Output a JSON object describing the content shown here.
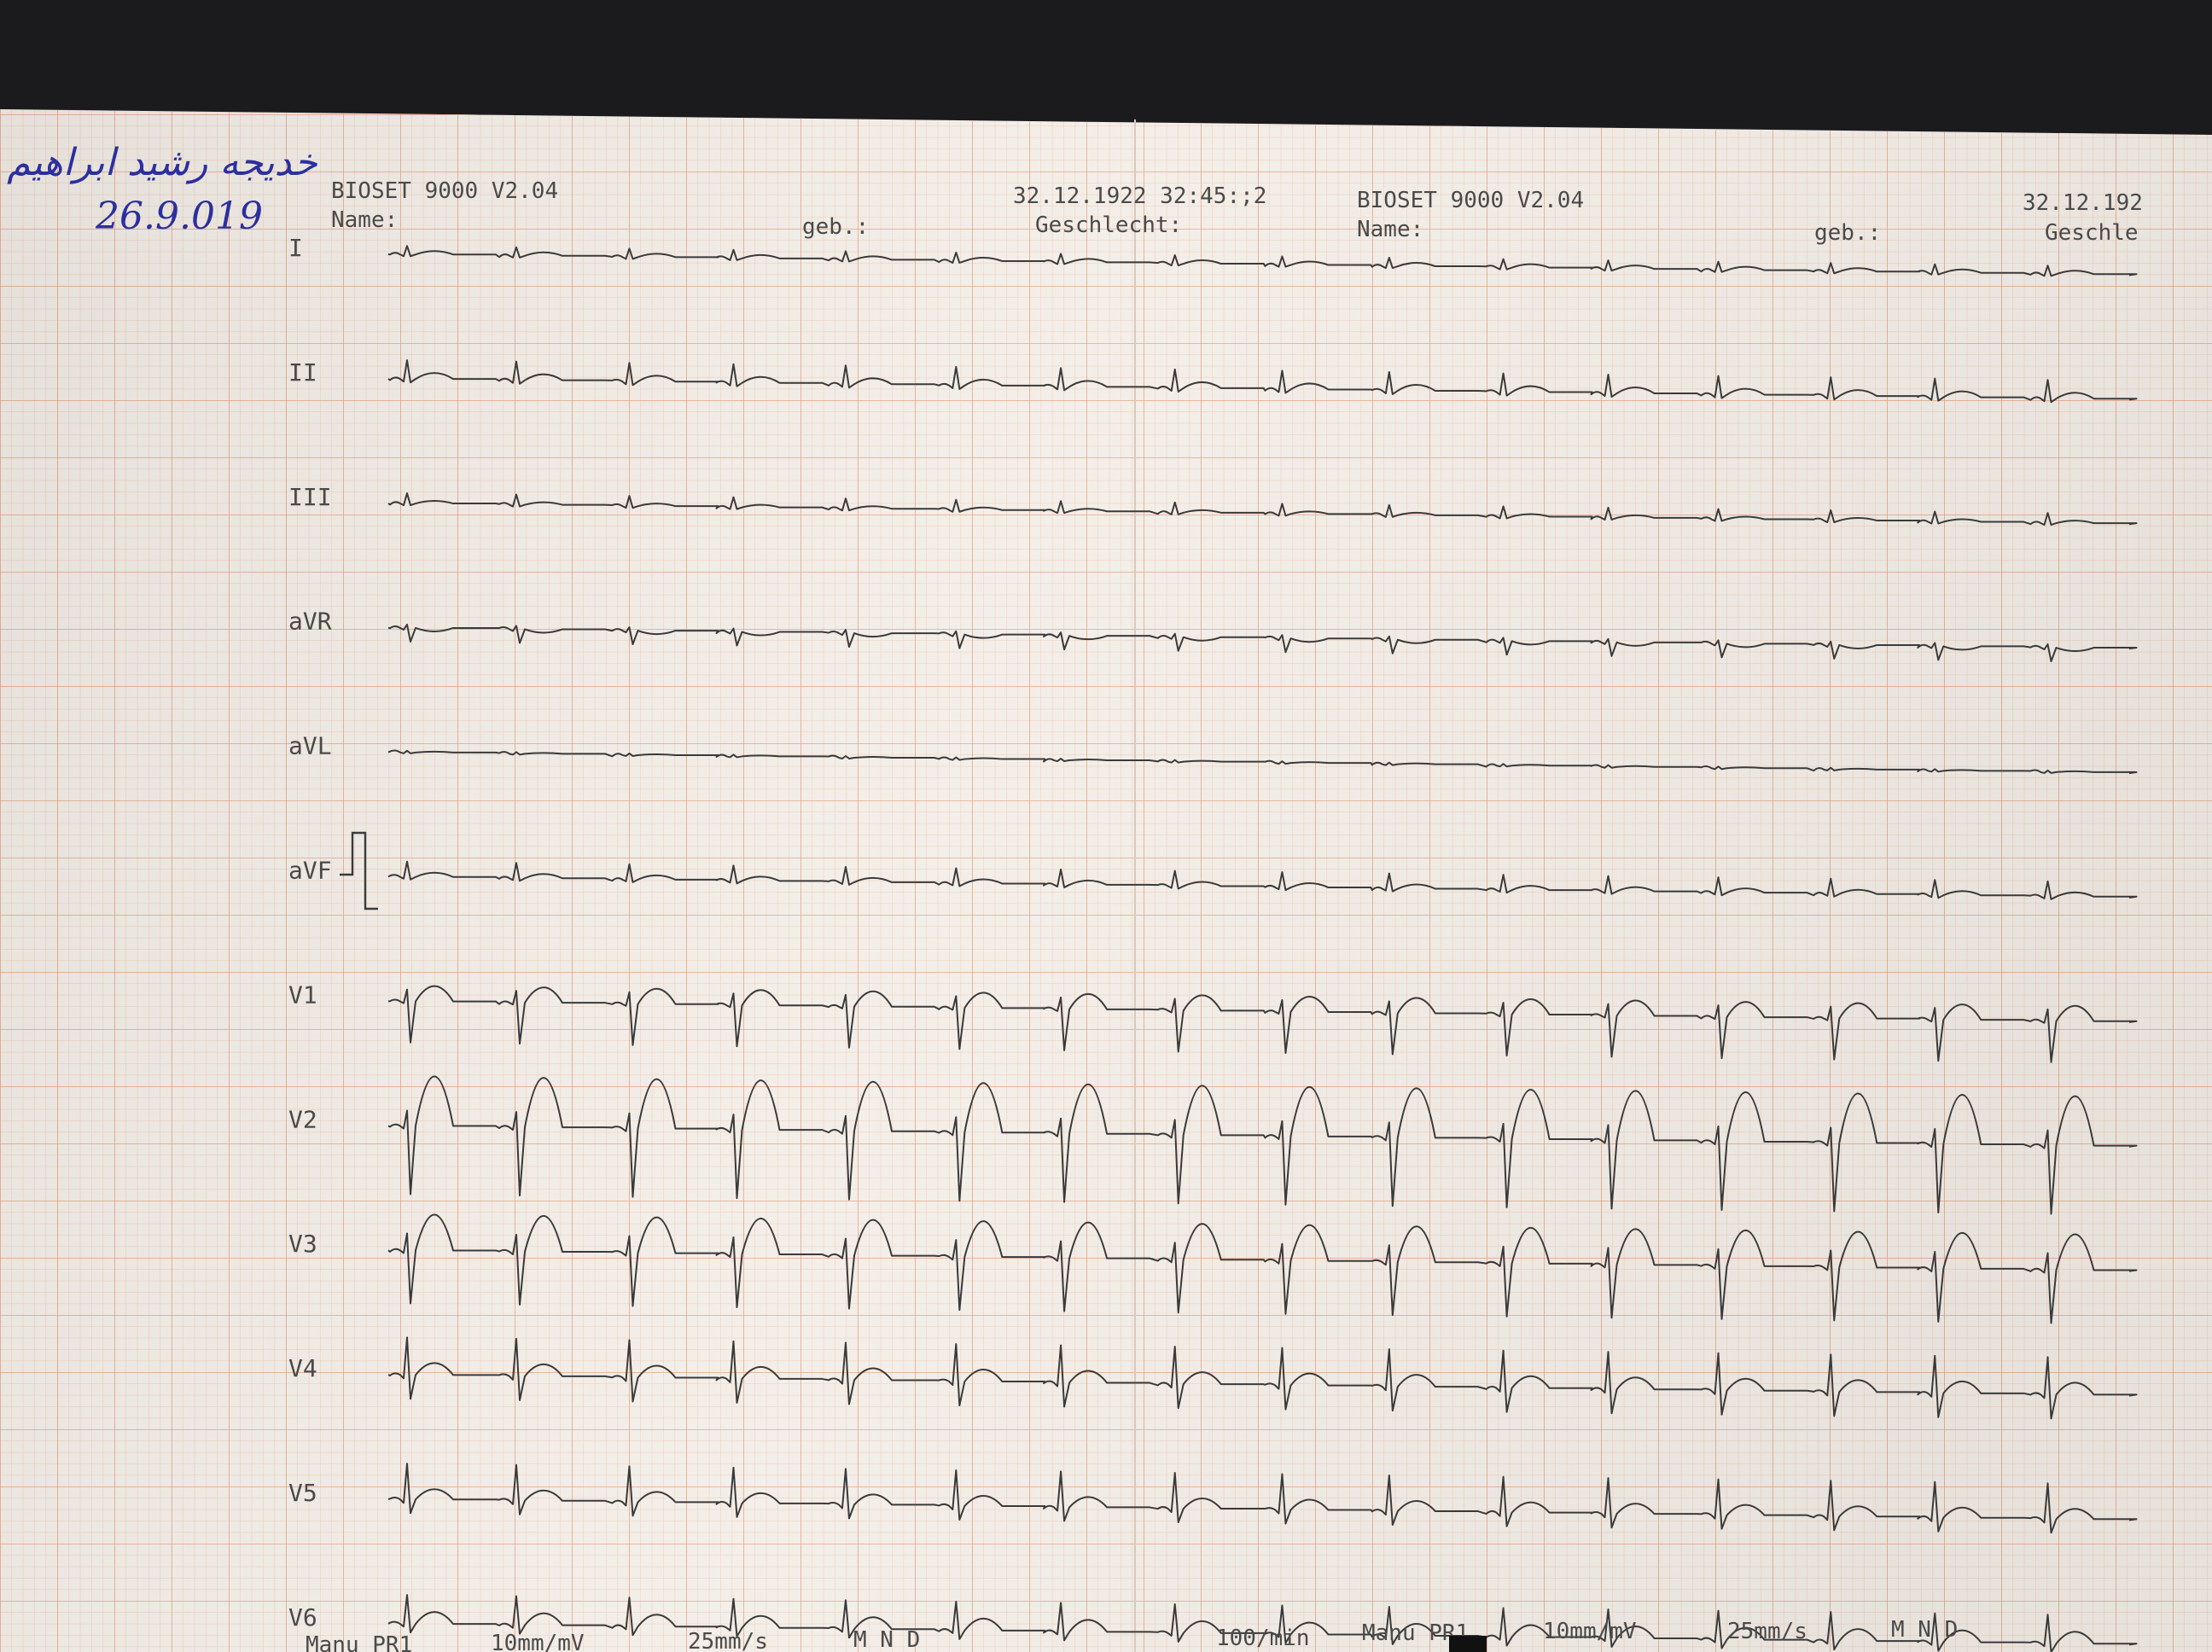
{
  "handwritten": {
    "name_arabic": "خديجه رشيد ابراهيم",
    "date": "26.9.019",
    "ink_color": "#2b2fa0"
  },
  "colors": {
    "background": "#1b1b1e",
    "paper": "#f3eee8",
    "grid_minor": "#f0cdb6",
    "grid_major": "#e8a47f",
    "trace": "#3a3a3a",
    "print_text": "#4a4a4a",
    "marker": "#111111"
  },
  "header_left": {
    "device": "BIOSET 9000 V2.04",
    "name_label": "Name:",
    "datetime": "32.12.1922 32:45:;2",
    "geb_label": "geb.:",
    "gender_label": "Geschlecht:"
  },
  "header_right": {
    "device": "BIOSET 9000 V2.04",
    "name_label": "Name:",
    "datetime": "32.12.192",
    "geb_label": "geb.:",
    "gender_label": "Geschle"
  },
  "leads": [
    {
      "label": "I",
      "r": 10,
      "t": 4,
      "q": -2,
      "s": -2
    },
    {
      "label": "II",
      "r": 22,
      "t": 7,
      "q": -3,
      "s": -4
    },
    {
      "label": "III",
      "r": 12,
      "t": 3,
      "q": -2,
      "s": -2
    },
    {
      "label": "aVR",
      "r": 4,
      "t": -4,
      "q": -2,
      "s": -16
    },
    {
      "label": "aVL",
      "r": 2,
      "t": 1,
      "q": -1,
      "s": -1
    },
    {
      "label": "aVF",
      "r": 18,
      "t": 5,
      "q": -2,
      "s": -3
    },
    {
      "label": "V1",
      "r": 14,
      "t": 18,
      "q": -2,
      "s": -48
    },
    {
      "label": "V2",
      "r": 18,
      "t": 58,
      "q": -3,
      "s": -80
    },
    {
      "label": "V3",
      "r": 20,
      "t": 42,
      "q": -3,
      "s": -62
    },
    {
      "label": "V4",
      "r": 44,
      "t": 14,
      "q": -4,
      "s": -28
    },
    {
      "label": "V5",
      "r": 42,
      "t": 12,
      "q": -4,
      "s": -16
    },
    {
      "label": "V6",
      "r": 34,
      "t": 14,
      "q": -3,
      "s": -10
    }
  ],
  "footer_left": {
    "mode": "Manu PR1",
    "gain": "10mm/mV",
    "speed": "25mm/s",
    "filters": "M  N  D"
  },
  "footer_right": {
    "rate": "100/min",
    "mode": "Manu PR1",
    "gain": "10mm/mV",
    "speed": "25mm/s",
    "filters": "M  N  D"
  }
}
